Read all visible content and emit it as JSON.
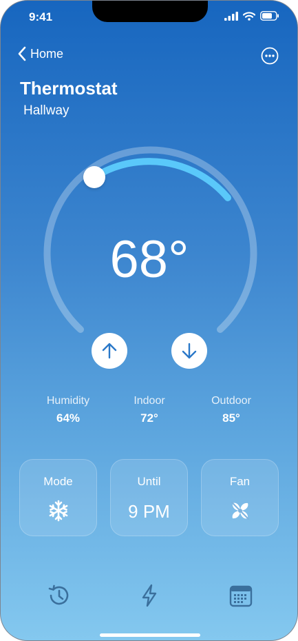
{
  "status_bar": {
    "time": "9:41"
  },
  "nav": {
    "back_label": "Home"
  },
  "header": {
    "title": "Thermostat",
    "subtitle": "Hallway"
  },
  "dial": {
    "temperature": "68°",
    "progress": 0.3
  },
  "stats": [
    {
      "label": "Humidity",
      "value": "64%"
    },
    {
      "label": "Indoor",
      "value": "72°"
    },
    {
      "label": "Outdoor",
      "value": "85°"
    }
  ],
  "tiles": {
    "mode": {
      "label": "Mode",
      "icon": "snowflake-icon"
    },
    "until": {
      "label": "Until",
      "value": "9 PM"
    },
    "fan": {
      "label": "Fan",
      "icon": "fan-icon"
    }
  },
  "tab_bar": {
    "items": [
      "history-icon",
      "bolt-icon",
      "calendar-icon"
    ]
  },
  "colors": {
    "accent": "#5ac8fa",
    "gradient_top": "#1766bf",
    "gradient_bottom": "#84c8ef"
  }
}
